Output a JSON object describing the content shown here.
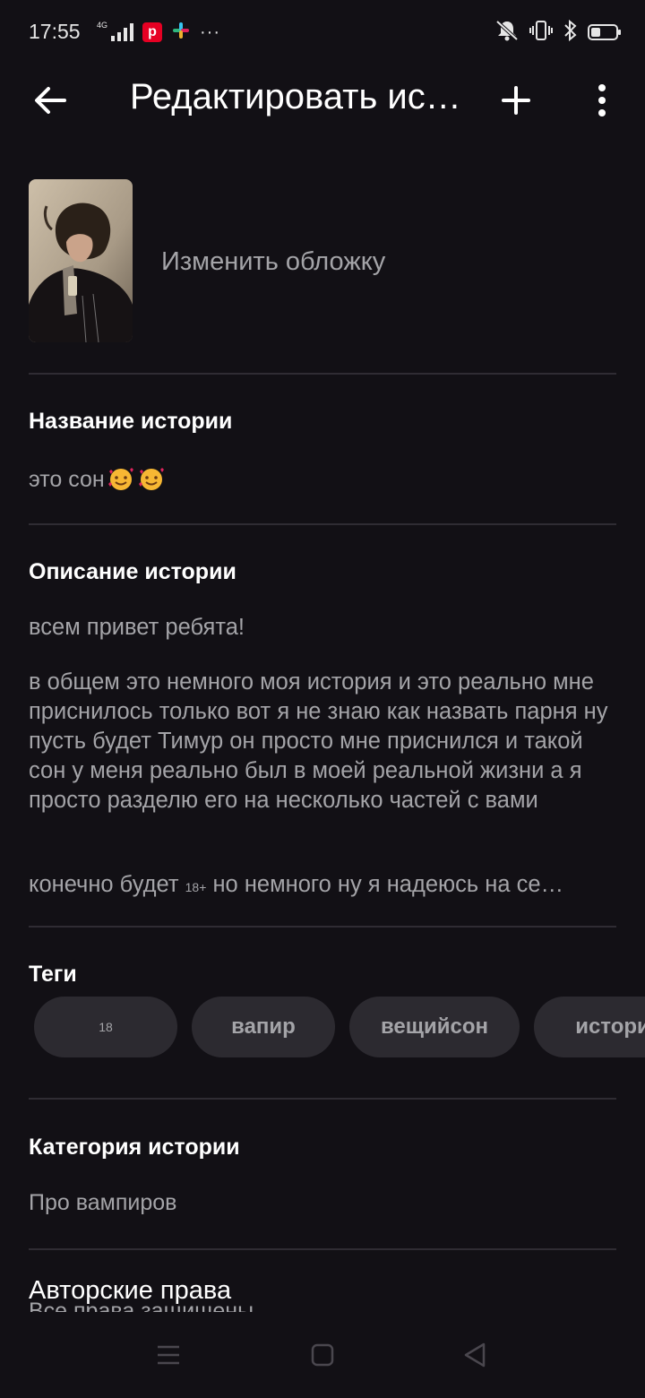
{
  "status_bar": {
    "time": "17:55",
    "network_label": "4G",
    "left_icons": [
      "signal-icon",
      "pinterest-icon",
      "slack-icon",
      "more-dots-icon"
    ],
    "right_icons": [
      "mute-icon",
      "vibrate-icon",
      "bluetooth-icon",
      "battery-icon"
    ]
  },
  "app_bar": {
    "title": "Редактировать ис…",
    "back_icon": "arrow-left-icon",
    "add_icon": "plus-icon",
    "more_icon": "vertical-dots-icon"
  },
  "cover": {
    "change_label": "Изменить обложку"
  },
  "story_title": {
    "label": "Название истории",
    "value": "это сон"
  },
  "story_description": {
    "label": "Описание истории",
    "paragraphs": [
      "всем привет ребята!",
      "в общем это немного моя история и это реально мне приснилось только вот я не знаю как назвать парня ну пусть будет Тимур он просто мне приснился и такой сон у меня реально был в моей реальной жизни а я просто разделю его на несколько частей с вами"
    ],
    "truncated_line_before": "конечно будет",
    "truncated_line_badge": "18+",
    "truncated_line_after": "но немного ну я надеюсь на се…"
  },
  "tags": {
    "label": "Теги",
    "items": [
      "18",
      "вапир",
      "вещийсон",
      "история"
    ]
  },
  "category": {
    "label": "Категория истории",
    "value": "Про вампиров"
  },
  "copyright": {
    "label": "Авторские права",
    "value": "Все права защищены"
  },
  "nav_bar": {
    "icons": [
      "menu-icon",
      "home-square-icon",
      "back-triangle-icon"
    ]
  },
  "colors": {
    "background": "#121015",
    "text_primary": "#ffffff",
    "text_secondary": "#a4a4a8",
    "divider": "#2f2c33",
    "chip_background": "#2c2a30"
  }
}
